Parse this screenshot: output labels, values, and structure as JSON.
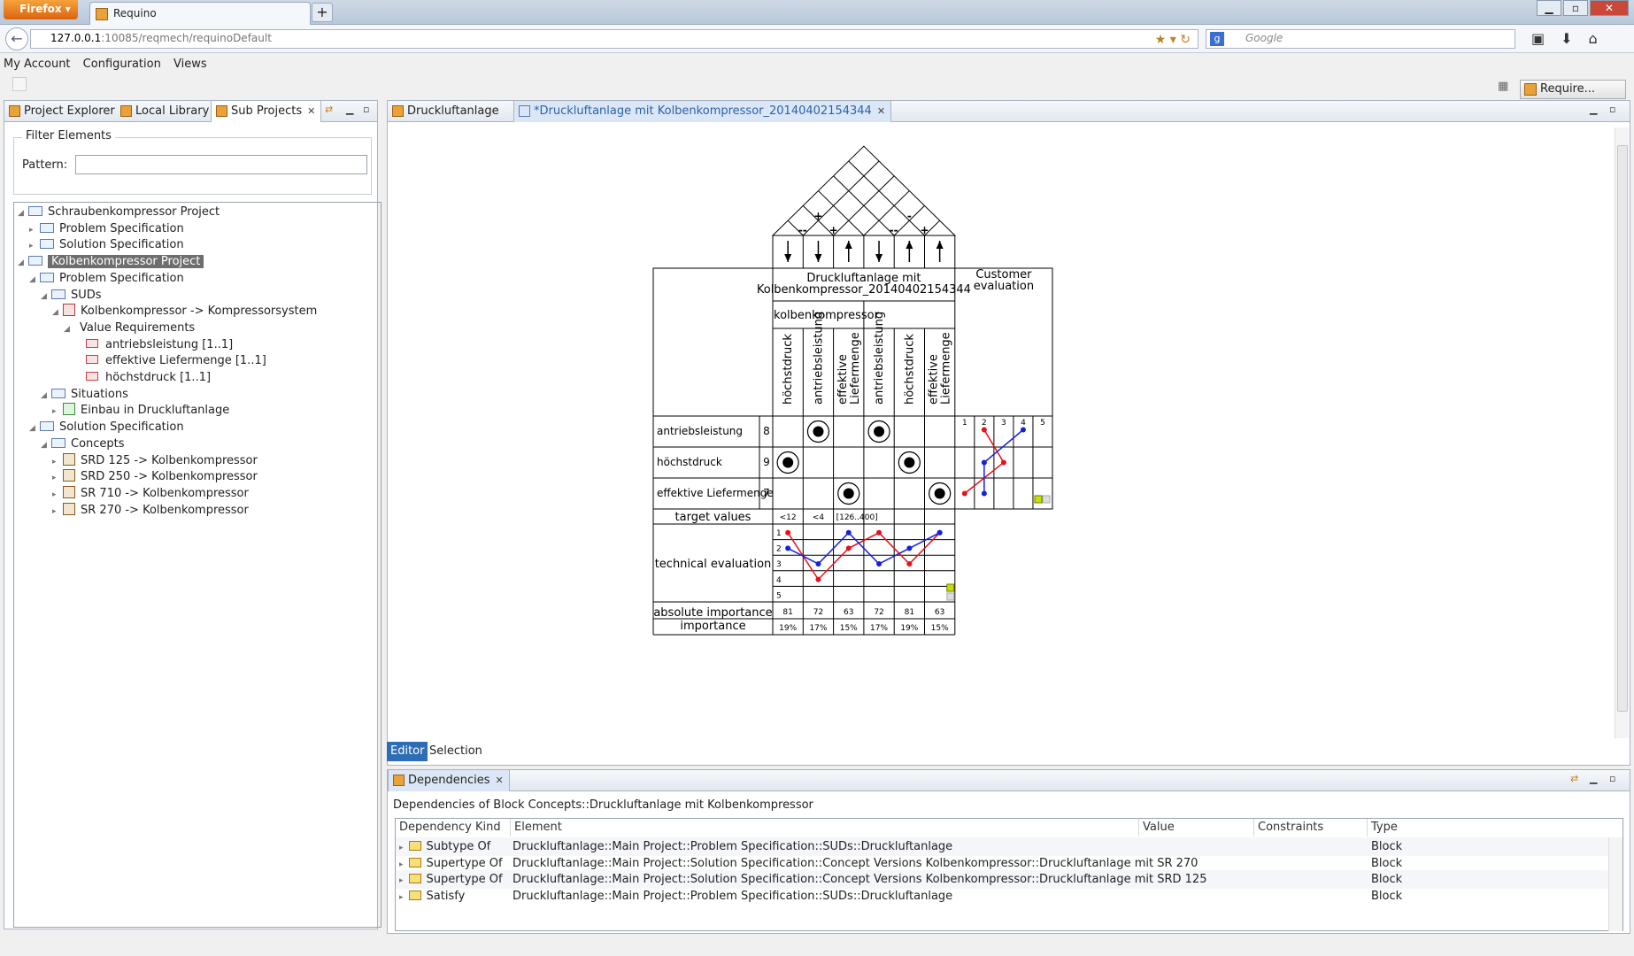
{
  "browser": {
    "firefox_label": "Firefox",
    "tab_title": "Requino",
    "new_tab": "+",
    "url_host": "127.0.0.1",
    "url_path": ":10085/reqmech/requinoDefault",
    "search_placeholder": "Google"
  },
  "menu": [
    "My Account",
    "Configuration",
    "Views"
  ],
  "toolbar": {
    "require_label": "Require..."
  },
  "left_tabs": [
    "Project Explorer",
    "Local Library",
    "Sub Projects"
  ],
  "filter": {
    "legend": "Filter Elements",
    "pattern_label": "Pattern:",
    "pattern_value": ""
  },
  "tree": [
    {
      "label": "Schraubenkompressor Project",
      "depth": 0,
      "icon": "folder",
      "expand": "open"
    },
    {
      "label": "Problem Specification",
      "depth": 1,
      "icon": "folder",
      "expand": "closed"
    },
    {
      "label": "Solution Specification",
      "depth": 1,
      "icon": "folder",
      "expand": "closed"
    },
    {
      "label": "Kolbenkompressor Project",
      "depth": 0,
      "icon": "folder",
      "expand": "open",
      "selected": true
    },
    {
      "label": "Problem Specification",
      "depth": 1,
      "icon": "folder",
      "expand": "open"
    },
    {
      "label": "SUDs",
      "depth": 2,
      "icon": "folder",
      "expand": "open"
    },
    {
      "label": "Kolbenkompressor -> Kompressorsystem",
      "depth": 3,
      "icon": "block-red",
      "expand": "open"
    },
    {
      "label": "Value Requirements",
      "depth": 4,
      "icon": "none",
      "expand": "open"
    },
    {
      "label": "antriebsleistung [1..1]",
      "depth": 5,
      "icon": "req",
      "expand": "none"
    },
    {
      "label": "effektive Liefermenge [1..1]",
      "depth": 5,
      "icon": "req",
      "expand": "none"
    },
    {
      "label": "höchstdruck [1..1]",
      "depth": 5,
      "icon": "req",
      "expand": "none"
    },
    {
      "label": "Situations",
      "depth": 2,
      "icon": "folder",
      "expand": "open"
    },
    {
      "label": "Einbau in Druckluftanlage",
      "depth": 3,
      "icon": "block-green",
      "expand": "closed"
    },
    {
      "label": "Solution Specification",
      "depth": 1,
      "icon": "folder",
      "expand": "open"
    },
    {
      "label": "Concepts",
      "depth": 2,
      "icon": "folder",
      "expand": "open"
    },
    {
      "label": "SRD 125 -> Kolbenkompressor",
      "depth": 3,
      "icon": "block-brown",
      "expand": "closed"
    },
    {
      "label": "SRD 250 -> Kolbenkompressor",
      "depth": 3,
      "icon": "block-brown",
      "expand": "closed"
    },
    {
      "label": "SR 710 -> Kolbenkompressor",
      "depth": 3,
      "icon": "block-brown",
      "expand": "closed"
    },
    {
      "label": "SR 270 -> Kolbenkompressor",
      "depth": 3,
      "icon": "block-brown",
      "expand": "closed"
    }
  ],
  "editor_tabs": [
    "Druckluftanlage",
    "*Druckluftanlage mit Kolbenkompressor_20140402154344"
  ],
  "qfd": {
    "roof_marks": [
      "--",
      "+",
      "+",
      "--",
      "-",
      "+"
    ],
    "directions": [
      "down",
      "down",
      "up",
      "down",
      "up",
      "up"
    ],
    "title_line1": "Druckluftanlage mit",
    "title_line2": "Kolbenkompressor_20140402154344",
    "group_label": "kolbenkompressor",
    "columns": [
      "höchstdruck",
      "antriebsleistung",
      "effektive Liefermenge",
      "antriebsleistung",
      "höchstdruck",
      "effektive Liefermenge"
    ],
    "customer_eval_line1": "Customer",
    "customer_eval_line2": "evaluation",
    "eval_scale": [
      "1",
      "2",
      "3",
      "4",
      "5"
    ],
    "rows": [
      {
        "name": "antriebsleistung",
        "weight": "8",
        "cells": [
          0,
          1,
          0,
          1,
          0,
          0
        ]
      },
      {
        "name": "höchstdruck",
        "weight": "9",
        "cells": [
          1,
          0,
          0,
          0,
          1,
          0
        ]
      },
      {
        "name": "effektive Liefermenge",
        "weight": "7",
        "cells": [
          0,
          0,
          1,
          0,
          0,
          1
        ]
      }
    ],
    "customer_red": [
      2,
      3,
      1
    ],
    "customer_blue": [
      4,
      2,
      2
    ],
    "target_label": "target values",
    "targets": [
      "<12",
      "<4",
      "[126..400]",
      "",
      "",
      ""
    ],
    "tech_eval_label": "technical evaluation",
    "tech_scale": [
      "1",
      "2",
      "3",
      "4",
      "5"
    ],
    "tech_red": [
      1,
      4,
      2,
      1,
      3,
      1
    ],
    "tech_blue": [
      2,
      3,
      1,
      3,
      2,
      1
    ],
    "abs_label": "absolute importance",
    "abs_values": [
      "81",
      "72",
      "63",
      "72",
      "81",
      "63"
    ],
    "imp_label": "importance",
    "imp_values": [
      "19%",
      "17%",
      "15%",
      "17%",
      "19%",
      "15%"
    ],
    "colors": {
      "red": "#e8101a",
      "blue": "#1420e0"
    }
  },
  "editor_bottom_tabs": [
    "Editor",
    "Selection"
  ],
  "dependencies": {
    "tab": "Dependencies",
    "title": "Dependencies of Block Concepts::Druckluftanlage mit Kolbenkompressor",
    "headers": [
      "Dependency Kind",
      "Element",
      "Value",
      "Constraints",
      "Type"
    ],
    "rows": [
      {
        "kind": "Subtype Of",
        "element": "Druckluftanlage::Main Project::Problem Specification::SUDs::Druckluftanlage",
        "value": "",
        "constraints": "",
        "type": "Block"
      },
      {
        "kind": "Supertype Of",
        "element": "Druckluftanlage::Main Project::Solution Specification::Concept Versions Kolbenkompressor::Druckluftanlage mit SR 270",
        "value": "",
        "constraints": "",
        "type": "Block"
      },
      {
        "kind": "Supertype Of",
        "element": "Druckluftanlage::Main Project::Solution Specification::Concept Versions Kolbenkompressor::Druckluftanlage mit SRD 125",
        "value": "",
        "constraints": "",
        "type": "Block"
      },
      {
        "kind": "Satisfy",
        "element": "Druckluftanlage::Main Project::Problem Specification::SUDs::Druckluftanlage",
        "value": "",
        "constraints": "",
        "type": "Block"
      }
    ]
  }
}
